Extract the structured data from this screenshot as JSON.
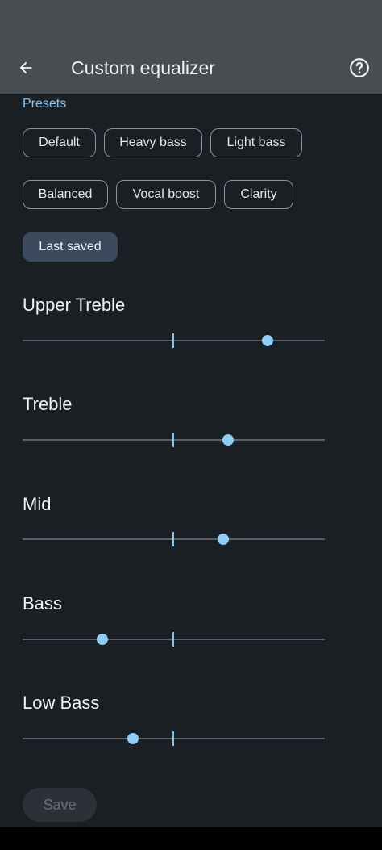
{
  "header": {
    "title": "Custom equalizer",
    "back_icon": "arrow-left-icon",
    "help_icon": "help-circle-icon"
  },
  "presets": {
    "label": "Presets",
    "chips": [
      {
        "label": "Default",
        "selected": false
      },
      {
        "label": "Heavy bass",
        "selected": false
      },
      {
        "label": "Light bass",
        "selected": false
      },
      {
        "label": "Balanced",
        "selected": false
      },
      {
        "label": "Vocal boost",
        "selected": false
      },
      {
        "label": "Clarity",
        "selected": false
      },
      {
        "label": "Last saved",
        "selected": true
      }
    ]
  },
  "bands": [
    {
      "label": "Upper Treble",
      "value": 0.81
    },
    {
      "label": "Treble",
      "value": 0.68
    },
    {
      "label": "Mid",
      "value": 0.665
    },
    {
      "label": "Bass",
      "value": 0.265
    },
    {
      "label": "Low Bass",
      "value": 0.365
    }
  ],
  "save": {
    "label": "Save",
    "enabled": false
  },
  "colors": {
    "accent": "#86c7f4",
    "header_bg": "#484d52",
    "page_bg": "#1a1f24",
    "selected_chip_bg": "#3b4a5c"
  }
}
